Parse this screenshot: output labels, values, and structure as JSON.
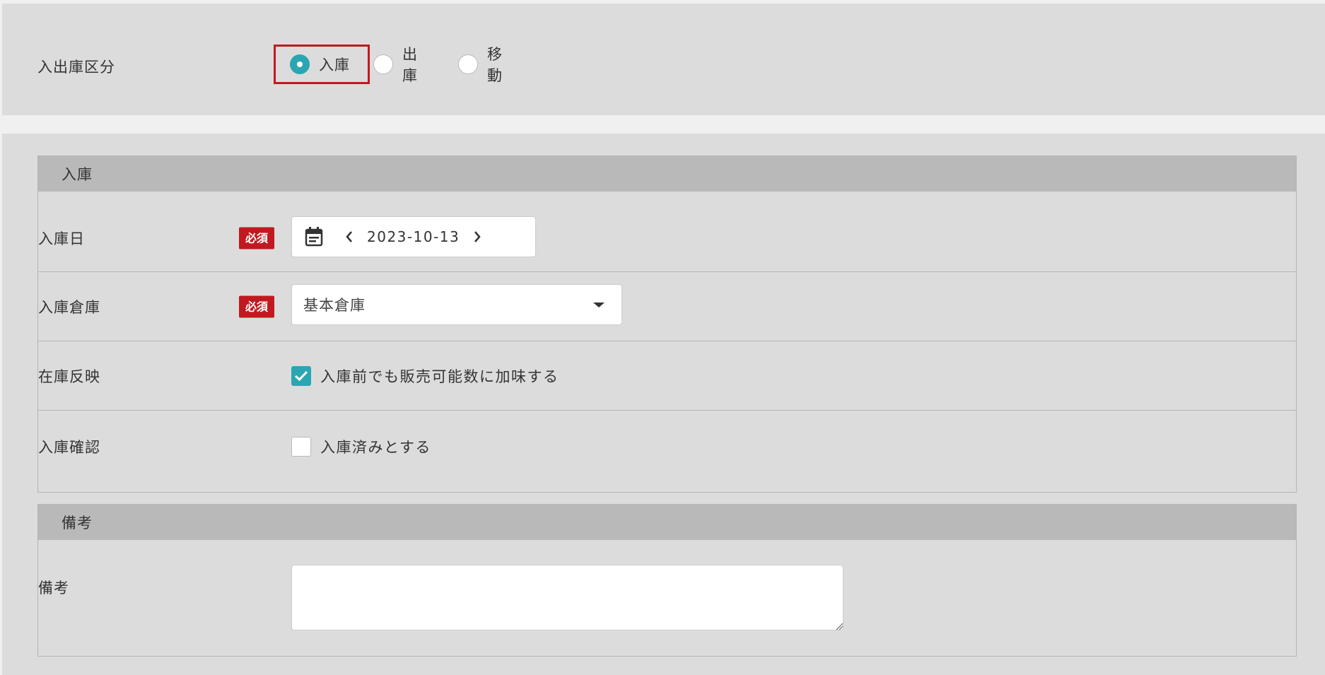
{
  "stock_type": {
    "label": "入出庫区分",
    "options": [
      {
        "label": "入庫",
        "selected": true
      },
      {
        "label": "出庫",
        "selected": false
      },
      {
        "label": "移動",
        "selected": false
      }
    ]
  },
  "receiving_section": {
    "title": "入庫",
    "required_badge": "必須",
    "date_row": {
      "label": "入庫日",
      "value": "2023-10-13"
    },
    "warehouse_row": {
      "label": "入庫倉庫",
      "value": "基本倉庫"
    },
    "stock_reflect_row": {
      "label": "在庫反映",
      "checkbox_label": "入庫前でも販売可能数に加味する",
      "checked": true
    },
    "confirm_row": {
      "label": "入庫確認",
      "checkbox_label": "入庫済みとする",
      "checked": false
    }
  },
  "notes_section": {
    "title": "備考",
    "notes_row": {
      "label": "備考",
      "value": ""
    }
  },
  "colors": {
    "accent": "#2aa6b3",
    "required": "#c0191f",
    "highlight": "#c0191f"
  }
}
